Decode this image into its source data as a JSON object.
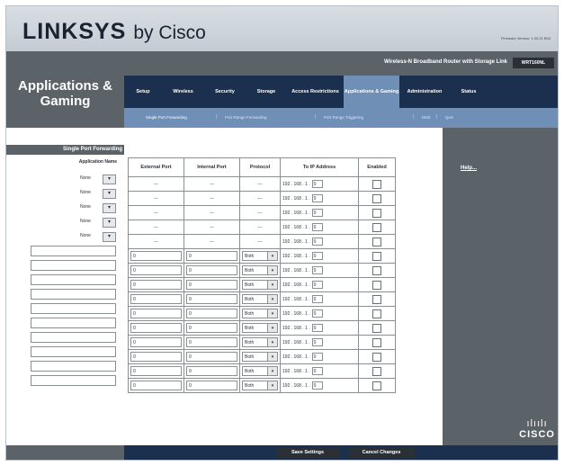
{
  "header": {
    "brand": "LINKSYS",
    "by": "by Cisco",
    "firmware": "Firmware Version: 1.00.21 B04"
  },
  "section_title": "Applications & Gaming",
  "product_name": "Wireless-N Broadband Router with Storage Link",
  "model": "WRT160NL",
  "tabs": [
    "Setup",
    "Wireless",
    "Security",
    "Storage",
    "Access Restrictions",
    "Applications & Gaming",
    "Administration",
    "Status"
  ],
  "subtabs": [
    "Single Port Forwarding",
    "Port Range Forwarding",
    "Port Range Triggering",
    "DMZ",
    "QoS"
  ],
  "left": {
    "section_header": "Single Port Forwarding",
    "app_name_label": "Application Name",
    "dropdown_values": [
      "None",
      "None",
      "None",
      "None",
      "None"
    ]
  },
  "table": {
    "headers": [
      "External Port",
      "Internal Port",
      "Protocol",
      "To IP Address",
      "Enabled"
    ],
    "dash": "---",
    "ip_prefix": "192 . 168 . 1 .",
    "ip_last": "0",
    "port_default": "0",
    "protocol_default": "Both"
  },
  "help_link": "Help...",
  "buttons": {
    "save": "Save Settings",
    "cancel": "Cancel Changes"
  },
  "logo": {
    "bars": "ılıılı",
    "text": "CISCO"
  },
  "colors": {
    "nav_blue": "#1b2f4e",
    "active_tab": "#6f8fb7",
    "panel_gray": "#5b6268"
  }
}
